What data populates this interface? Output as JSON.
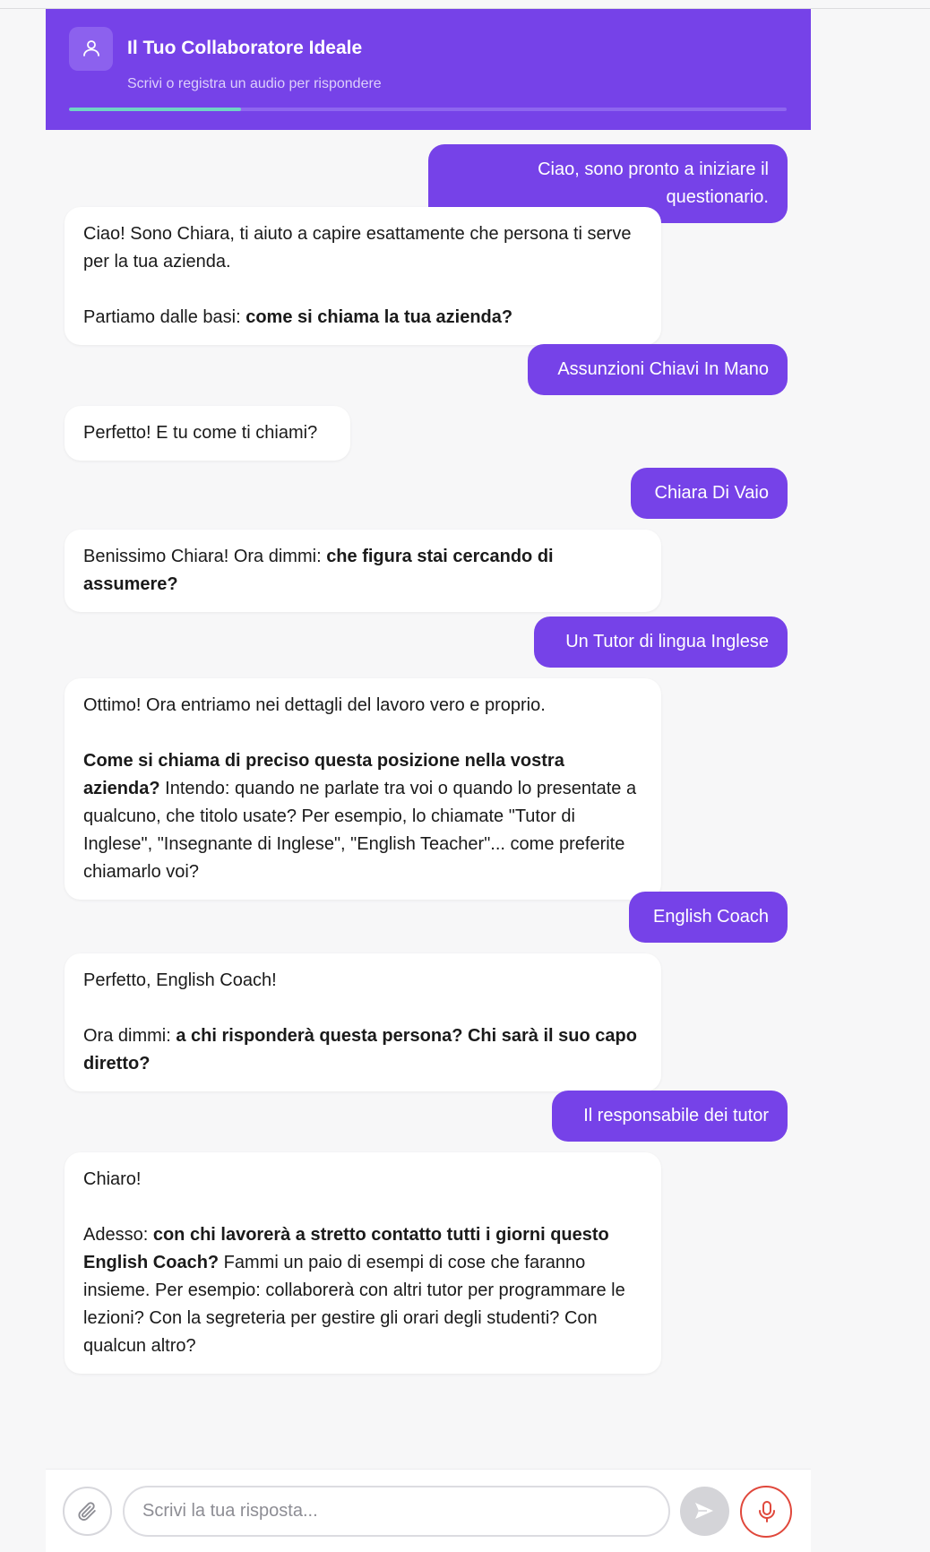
{
  "header": {
    "title": "Il Tuo Collaboratore Ideale",
    "subtitle": "Scrivi o registra un audio per rispondere",
    "progress_fraction": 0.24,
    "avatar_icon": "user-icon"
  },
  "colors": {
    "accent": "#7642e8",
    "progress_fill": "#6fd3c6",
    "mic": "#e0483c",
    "background": "#f7f7f8"
  },
  "messages": [
    {
      "role": "user",
      "parts": [
        {
          "t": "Ciao, sono pronto a iniziare il questionario."
        }
      ]
    },
    {
      "role": "bot",
      "parts": [
        {
          "t": "Ciao! Sono Chiara, ti aiuto a capire esattamente che persona ti serve per la tua azienda.\n\nPartiamo dalle basi: "
        },
        {
          "t": "come si chiama la tua azienda?",
          "b": true
        }
      ]
    },
    {
      "role": "user",
      "parts": [
        {
          "t": "Assunzioni Chiavi In Mano"
        }
      ]
    },
    {
      "role": "bot",
      "parts": [
        {
          "t": "Perfetto! E tu come ti chiami?"
        }
      ]
    },
    {
      "role": "user",
      "parts": [
        {
          "t": "Chiara Di Vaio"
        }
      ]
    },
    {
      "role": "bot",
      "parts": [
        {
          "t": "Benissimo Chiara! Ora dimmi: "
        },
        {
          "t": "che figura stai cercando di assumere?",
          "b": true
        }
      ]
    },
    {
      "role": "user",
      "parts": [
        {
          "t": "Un Tutor di lingua Inglese"
        }
      ]
    },
    {
      "role": "bot",
      "parts": [
        {
          "t": "Ottimo! Ora entriamo nei dettagli del lavoro vero e proprio.\n\n"
        },
        {
          "t": "Come si chiama di preciso questa posizione nella vostra azienda?",
          "b": true
        },
        {
          "t": " Intendo: quando ne parlate tra voi o quando lo presentate a qualcuno, che titolo usate? Per esempio, lo chiamate \"Tutor di Inglese\", \"Insegnante di Inglese\", \"English Teacher\"... come preferite chiamarlo voi?"
        }
      ]
    },
    {
      "role": "user",
      "parts": [
        {
          "t": "English Coach"
        }
      ]
    },
    {
      "role": "bot",
      "parts": [
        {
          "t": "Perfetto, English Coach!\n\nOra dimmi: "
        },
        {
          "t": "a chi risponderà questa persona? Chi sarà il suo capo diretto?",
          "b": true
        }
      ]
    },
    {
      "role": "user",
      "parts": [
        {
          "t": "Il responsabile dei tutor"
        }
      ]
    },
    {
      "role": "bot",
      "parts": [
        {
          "t": "Chiaro!\n\nAdesso: "
        },
        {
          "t": "con chi lavorerà a stretto contatto tutti i giorni questo English Coach?",
          "b": true
        },
        {
          "t": " Fammi un paio di esempi di cose che faranno insieme. Per esempio: collaborerà con altri tutor per programmare le lezioni? Con la segreteria per gestire gli orari degli studenti? Con qualcun altro?"
        }
      ]
    }
  ],
  "composer": {
    "placeholder": "Scrivi la tua risposta...",
    "value": "",
    "attach_icon": "paperclip-icon",
    "send_icon": "send-icon",
    "mic_icon": "microphone-icon"
  }
}
